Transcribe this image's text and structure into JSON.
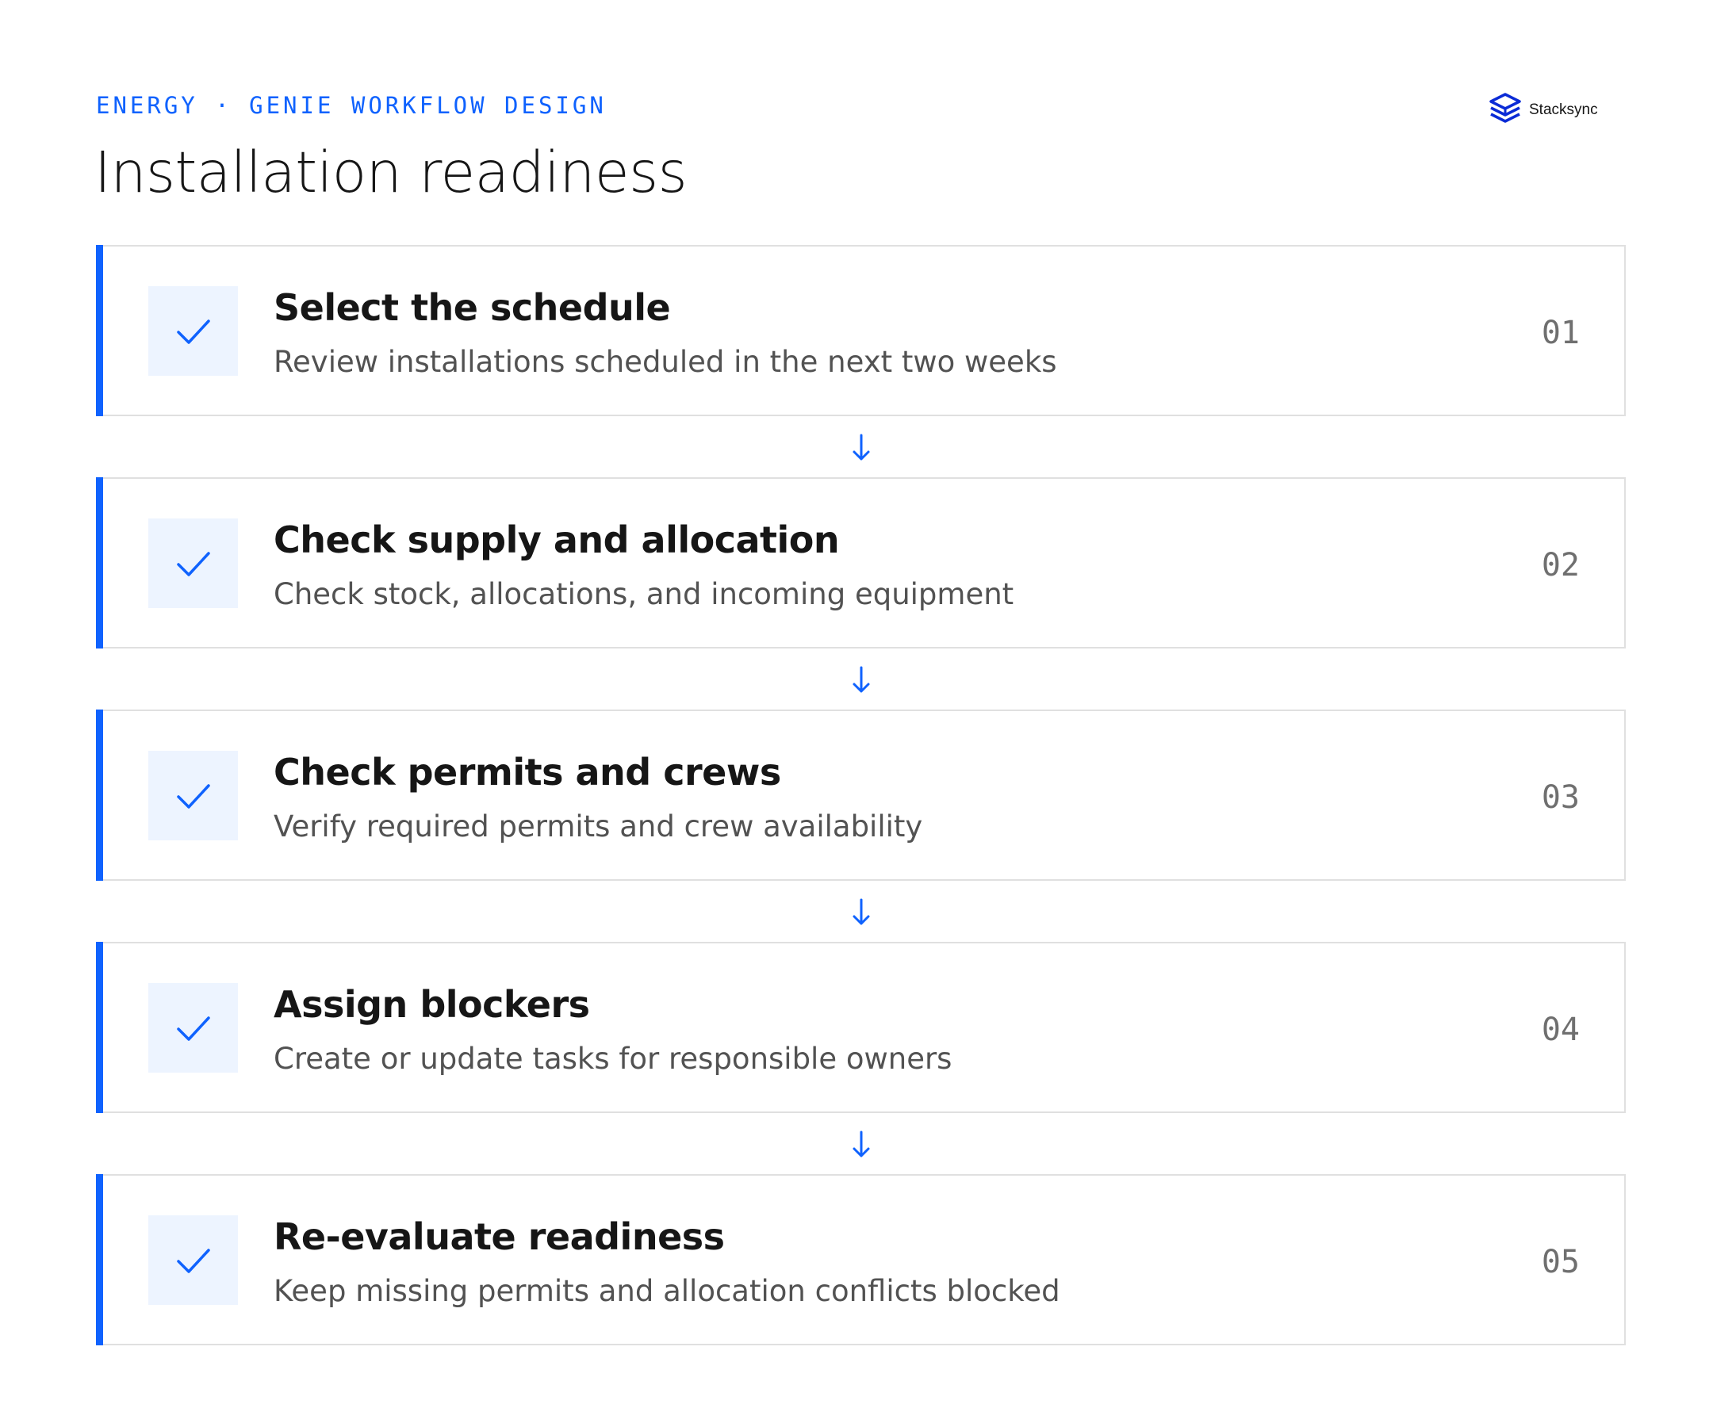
{
  "header": {
    "eyebrow": "ENERGY · GENIE WORKFLOW DESIGN",
    "title": "Installation readiness"
  },
  "brand": {
    "name": "Stacksync",
    "logo_icon": "stacked-layers-logo-icon",
    "logo_color": "#0b2bd6"
  },
  "colors": {
    "accent": "#0f62fe",
    "check_bg": "#edf4ff",
    "border": "#e0e0e0"
  },
  "steps": [
    {
      "title": "Select the schedule",
      "description": "Review installations scheduled in the next two weeks",
      "number": "01",
      "icon": "check-icon"
    },
    {
      "title": "Check supply and allocation",
      "description": "Check stock, allocations, and incoming equipment",
      "number": "02",
      "icon": "check-icon"
    },
    {
      "title": "Check permits and crews",
      "description": "Verify required permits and crew availability",
      "number": "03",
      "icon": "check-icon"
    },
    {
      "title": "Assign blockers",
      "description": "Create or update tasks for responsible owners",
      "number": "04",
      "icon": "check-icon"
    },
    {
      "title": "Re-evaluate readiness",
      "description": "Keep missing permits and allocation conflicts blocked",
      "number": "05",
      "icon": "check-icon"
    }
  ],
  "connector_icon": "arrow-down-icon"
}
